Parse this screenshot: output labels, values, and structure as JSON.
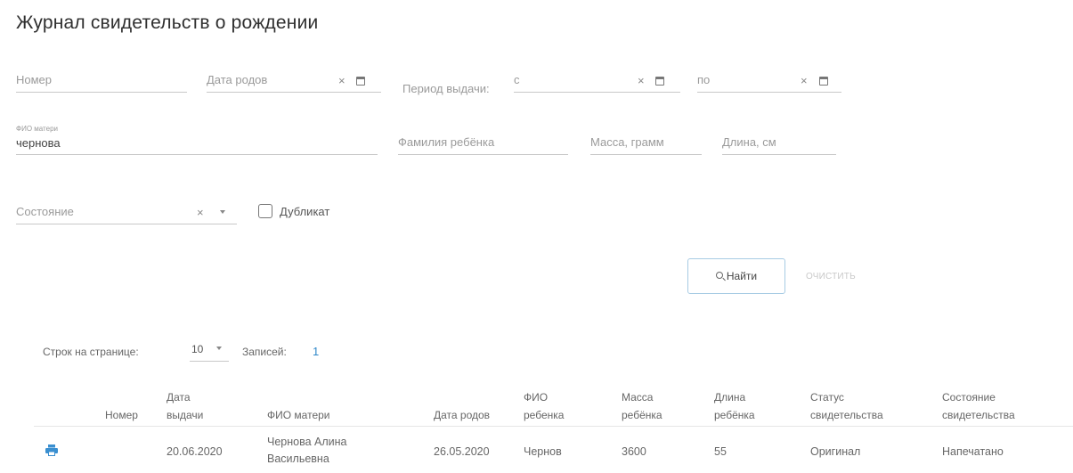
{
  "page": {
    "title": "Журнал свидетельств о рождении"
  },
  "filters": {
    "number_placeholder": "Номер",
    "birth_date_placeholder": "Дата родов",
    "issue_period_label": "Период выдачи:",
    "period_from_placeholder": "с",
    "period_to_placeholder": "по",
    "mother_name_label": "ФИО матери",
    "mother_name_value": "чернова",
    "child_surname_placeholder": "Фамилия ребёнка",
    "weight_placeholder": "Масса, грамм",
    "length_placeholder": "Длина, см",
    "state_placeholder": "Состояние",
    "duplicate_label": "Дубликат",
    "duplicate_checked": false,
    "clear_glyph": "×"
  },
  "actions": {
    "find_label": "Найти",
    "clear_label": "очистить"
  },
  "pagination": {
    "rows_per_page_label": "Строк на странице:",
    "rows_per_page_value": "10",
    "records_label": "Записей:",
    "records_count": "1"
  },
  "table": {
    "headers": {
      "number": "Номер",
      "issue_date_1": "Дата",
      "issue_date_2": "выдачи",
      "mother_name": "ФИО матери",
      "birth_date": "Дата родов",
      "child_name_1": "ФИО",
      "child_name_2": "ребенка",
      "child_weight_1": "Масса",
      "child_weight_2": "ребёнка",
      "child_length_1": "Длина",
      "child_length_2": "ребёнка",
      "cert_status_1": "Статус",
      "cert_status_2": "свидетельства",
      "cert_state_1": "Состояние",
      "cert_state_2": "свидетельства"
    },
    "rows": [
      {
        "print_icon": "printer-icon",
        "number": "",
        "issue_date": "20.06.2020",
        "mother_name_1": "Чернова Алина",
        "mother_name_2": "Васильевна",
        "birth_date": "26.05.2020",
        "child_name": "Чернов",
        "child_weight": "3600",
        "child_length": "55",
        "cert_status": "Оригинал",
        "cert_state": "Напечатано"
      }
    ]
  },
  "colors": {
    "accent": "#2f88c9",
    "button_border": "#a7cbe4",
    "print_icon": "#3a8fd0"
  }
}
